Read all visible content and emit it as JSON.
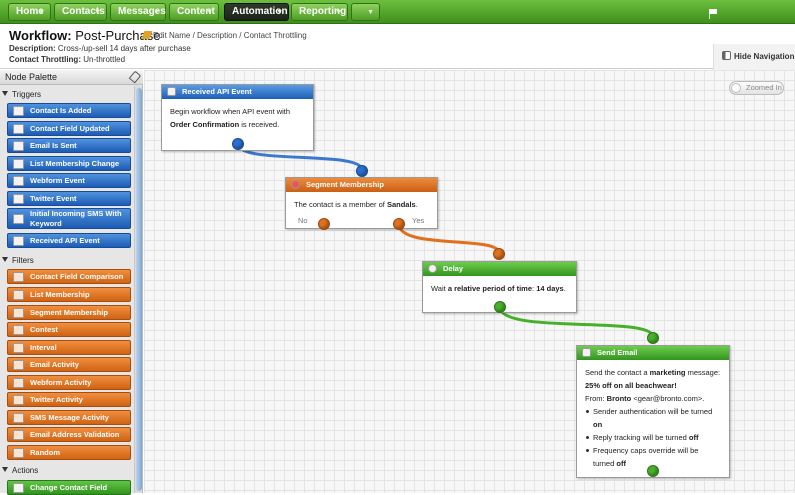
{
  "nav": {
    "items": [
      {
        "label": "Home"
      },
      {
        "label": "Contacts"
      },
      {
        "label": "Messages"
      },
      {
        "label": "Content"
      },
      {
        "label": "Automation",
        "active": true
      },
      {
        "label": "Reporting"
      }
    ],
    "flag_icon": "flag-icon"
  },
  "workflow": {
    "title_prefix": "Workflow:",
    "title_name": "Post-Purchase",
    "links": "Edit Name / Description / Contact Throttling",
    "description_label": "Description:",
    "description_value": "Cross-/up-sell 14 days after purchase",
    "throttling_label": "Contact Throttling:",
    "throttling_value": "Un-throttled"
  },
  "hide_navigation": "Hide Navigation",
  "palette": {
    "title": "Node Palette",
    "sections": {
      "triggers": "Triggers",
      "filters": "Filters",
      "actions": "Actions"
    },
    "triggers": [
      "Contact Is Added",
      "Contact Field Updated",
      "Email Is Sent",
      "List Membership Change",
      "Webform Event",
      "Twitter Event",
      "Initial Incoming SMS With Keyword",
      "Received API Event"
    ],
    "filters": [
      "Contact Field Comparison",
      "List Membership",
      "Segment Membership",
      "Contest",
      "Interval",
      "Email Activity",
      "Webform Activity",
      "Twitter Activity",
      "SMS Message Activity",
      "Email Address Validation",
      "Random"
    ],
    "actions": [
      "Change Contact Field"
    ]
  },
  "canvas": {
    "zoom_label": "Zoomed In",
    "nodes": {
      "api": {
        "title": "Received API Event",
        "t1": "Begin workflow when API event with ",
        "t2": "Order Confirmation",
        "t3": " is received."
      },
      "segment": {
        "title": "Segment Membership",
        "t1": "The contact is a member of ",
        "t2": "Sandals",
        "t3": ".",
        "no": "No",
        "yes": "Yes"
      },
      "delay": {
        "title": "Delay",
        "t1": "Wait ",
        "t2": "a relative period of time",
        "t3": ": ",
        "t4": "14 days",
        "t5": "."
      },
      "email": {
        "title": "Send Email",
        "l1a": "Send the contact a ",
        "l1b": "marketing",
        "l1c": " message:",
        "l2": "25% off on all beachwear!",
        "l3a": "From: ",
        "l3b": "Bronto",
        "l3c": " <gear@bronto.com>.",
        "b1a": "Sender authentication will be turned ",
        "b1b": "on",
        "b2a": "Reply tracking will be turned ",
        "b2b": "off",
        "b3a": "Frequency caps override will be turned ",
        "b3b": "off"
      }
    }
  }
}
